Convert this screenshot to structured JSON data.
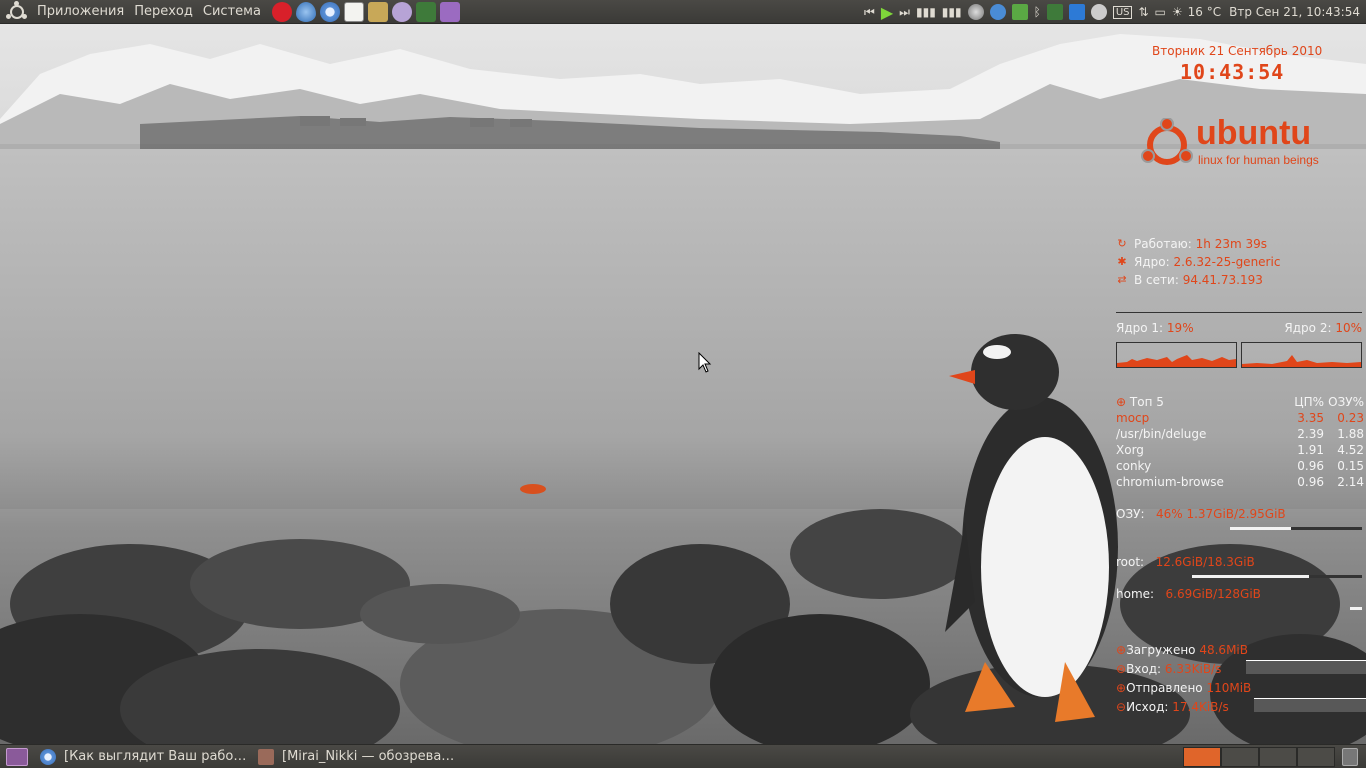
{
  "top_panel": {
    "menus": [
      "Приложения",
      "Переход",
      "Система"
    ],
    "launchers": [
      "lastfm-icon",
      "pidgin-drop-icon",
      "chromium-icon",
      "text-editor-icon",
      "file-manager-icon",
      "empathy-icon",
      "download-icon",
      "remote-desktop-icon"
    ],
    "tray": {
      "media_controls": [
        "previous-icon",
        "play-icon",
        "next-icon"
      ],
      "weather": "16 °C",
      "clock": "Втр Сен 21, 10:43:54",
      "keyboard_layout": "US"
    }
  },
  "conky": {
    "date": "Вторник 21 Сентябрь 2010",
    "time": "10:43:54",
    "brand_word": "ubuntu",
    "brand_tagline": "linux for human beings",
    "uptime_label": "Работаю:",
    "uptime_value": "1h 23m 39s",
    "kernel_label": "Ядро:",
    "kernel_value": "2.6.32-25-generic",
    "network_label": "В сети:",
    "network_value": "94.41.73.193",
    "core1_label": "Ядро 1:",
    "core1_value": "19%",
    "core2_label": "Ядро 2:",
    "core2_value": "10%",
    "top5_title": "Топ 5",
    "top5_cpu_header": "ЦП%",
    "top5_mem_header": "ОЗУ%",
    "processes": [
      {
        "name": "mocp",
        "cpu": "3.35",
        "mem": "0.23"
      },
      {
        "name": "/usr/bin/deluge",
        "cpu": "2.39",
        "mem": "1.88"
      },
      {
        "name": "Xorg",
        "cpu": "1.91",
        "mem": "4.52"
      },
      {
        "name": "conky",
        "cpu": "0.96",
        "mem": "0.15"
      },
      {
        "name": "chromium-browse",
        "cpu": "0.96",
        "mem": "2.14"
      }
    ],
    "ram_label": "ОЗУ:",
    "ram_value": "46% 1.37GiB/2.95GiB",
    "ram_fraction": 0.46,
    "root_label": "root:",
    "root_value": "12.6GiB/18.3GiB",
    "root_fraction": 0.69,
    "home_label": "home:",
    "home_value": "6.69GiB/128GiB",
    "home_fraction": 0.05,
    "downloaded_label": "Загружено",
    "downloaded_value": "48.6MiB",
    "in_label": "Вход:",
    "in_value": "6.33KiB/s",
    "sent_label": "Отправлено",
    "sent_value": "110MiB",
    "out_label": "Исход:",
    "out_value": "17.4KiB/s",
    "accent_color": "#e0461a"
  },
  "taskbar": {
    "tasks": [
      {
        "label": "[Как выглядит Ваш рабо…",
        "icon": "chromium-icon"
      },
      {
        "label": "[Mirai_Nikki — обозрева…",
        "icon": "book-icon"
      }
    ],
    "workspaces": 4,
    "active_workspace": 1
  }
}
